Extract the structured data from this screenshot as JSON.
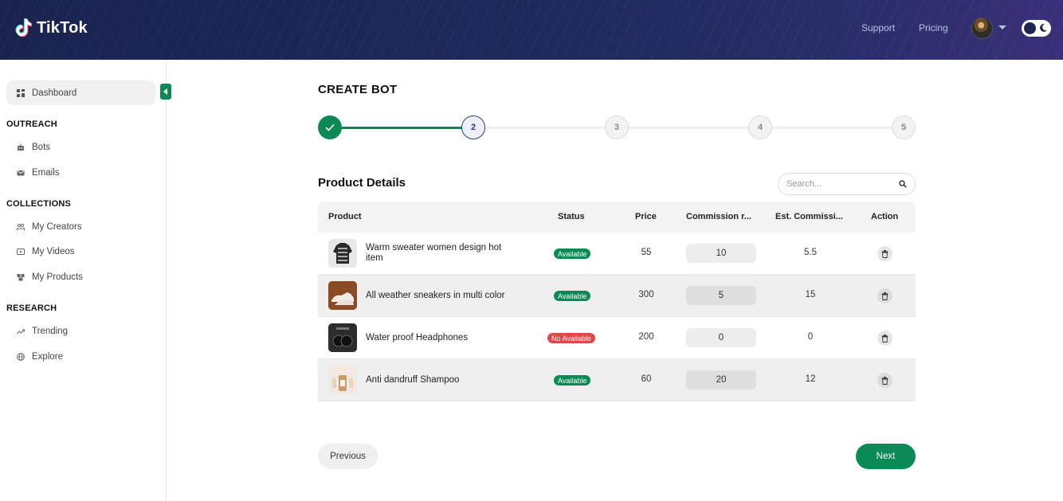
{
  "app": {
    "name": "TikTok"
  },
  "header": {
    "support_label": "Support",
    "pricing_label": "Pricing"
  },
  "sidebar": {
    "dashboard": "Dashboard",
    "sections": [
      {
        "title": "OUTREACH",
        "items": [
          "Bots",
          "Emails"
        ]
      },
      {
        "title": "COLLECTIONS",
        "items": [
          "My Creators",
          "My Videos",
          "My Products"
        ]
      },
      {
        "title": "RESEARCH",
        "items": [
          "Trending",
          "Explore"
        ]
      }
    ]
  },
  "main": {
    "title": "CREATE BOT",
    "stepper": {
      "current": 2,
      "steps": [
        {
          "label": "",
          "state": "done"
        },
        {
          "label": "2",
          "state": "current"
        },
        {
          "label": "3",
          "state": "pending"
        },
        {
          "label": "4",
          "state": "pending"
        },
        {
          "label": "5",
          "state": "pending"
        }
      ]
    },
    "section_title": "Product Details",
    "search": {
      "placeholder": "Search...",
      "value": ""
    },
    "table": {
      "headers": {
        "product": "Product",
        "status": "Status",
        "price": "Price",
        "commission_rate": "Commission r...",
        "est_commission": "Est. Commissi...",
        "action": "Action"
      },
      "rows": [
        {
          "name": "Warm sweater women design hot item",
          "status": "Available",
          "price": "55",
          "commission_rate": "10",
          "est_commission": "5.5"
        },
        {
          "name": "All weather sneakers in multi color",
          "status": "Available",
          "price": "300",
          "commission_rate": "5",
          "est_commission": "15"
        },
        {
          "name": "Water proof Headphones",
          "status": "No Available",
          "price": "200",
          "commission_rate": "0",
          "est_commission": "0"
        },
        {
          "name": "Anti dandruff Shampoo",
          "status": "Available",
          "price": "60",
          "commission_rate": "20",
          "est_commission": "12"
        }
      ]
    },
    "buttons": {
      "previous": "Previous",
      "next": "Next"
    }
  },
  "colors": {
    "header_bg": "#1e2a5c",
    "accent_green": "#0b8a55",
    "unavailable_red": "#e04848",
    "current_step_blue": "#283c8c"
  }
}
